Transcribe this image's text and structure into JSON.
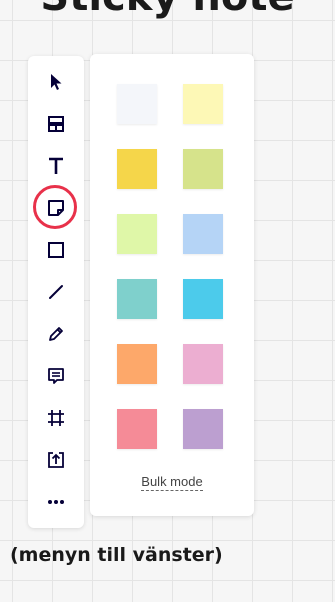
{
  "captions": {
    "top": "Sticky note",
    "bottom": "(menyn till vänster)"
  },
  "toolbar": {
    "tools": [
      {
        "name": "select-tool",
        "icon": "cursor-arrow-icon"
      },
      {
        "name": "templates-tool",
        "icon": "templates-icon"
      },
      {
        "name": "text-tool",
        "icon": "text-t-icon"
      },
      {
        "name": "sticky-note-tool",
        "icon": "sticky-note-icon",
        "highlighted": true
      },
      {
        "name": "shape-tool",
        "icon": "square-icon"
      },
      {
        "name": "line-tool",
        "icon": "line-icon"
      },
      {
        "name": "pen-tool",
        "icon": "pen-icon"
      },
      {
        "name": "comment-tool",
        "icon": "comment-icon"
      },
      {
        "name": "frame-tool",
        "icon": "frame-icon"
      },
      {
        "name": "upload-tool",
        "icon": "upload-icon"
      },
      {
        "name": "more-tools",
        "icon": "more-dots-icon"
      }
    ],
    "highlight_color": "#e8314a"
  },
  "sticky_panel": {
    "colors": [
      {
        "name": "white",
        "hex": "#f4f6fa"
      },
      {
        "name": "light-yellow",
        "hex": "#fdf8b6"
      },
      {
        "name": "yellow",
        "hex": "#f5d64a"
      },
      {
        "name": "olive-green",
        "hex": "#d6e38b"
      },
      {
        "name": "light-green",
        "hex": "#dff7a8"
      },
      {
        "name": "light-blue",
        "hex": "#b5d4f6"
      },
      {
        "name": "teal",
        "hex": "#7fd0cc"
      },
      {
        "name": "cyan",
        "hex": "#4ccbeb"
      },
      {
        "name": "orange",
        "hex": "#fda86a"
      },
      {
        "name": "pink",
        "hex": "#ecaed1"
      },
      {
        "name": "red",
        "hex": "#f58b97"
      },
      {
        "name": "purple",
        "hex": "#bc9fd0"
      }
    ],
    "bulk_mode_label": "Bulk mode"
  }
}
